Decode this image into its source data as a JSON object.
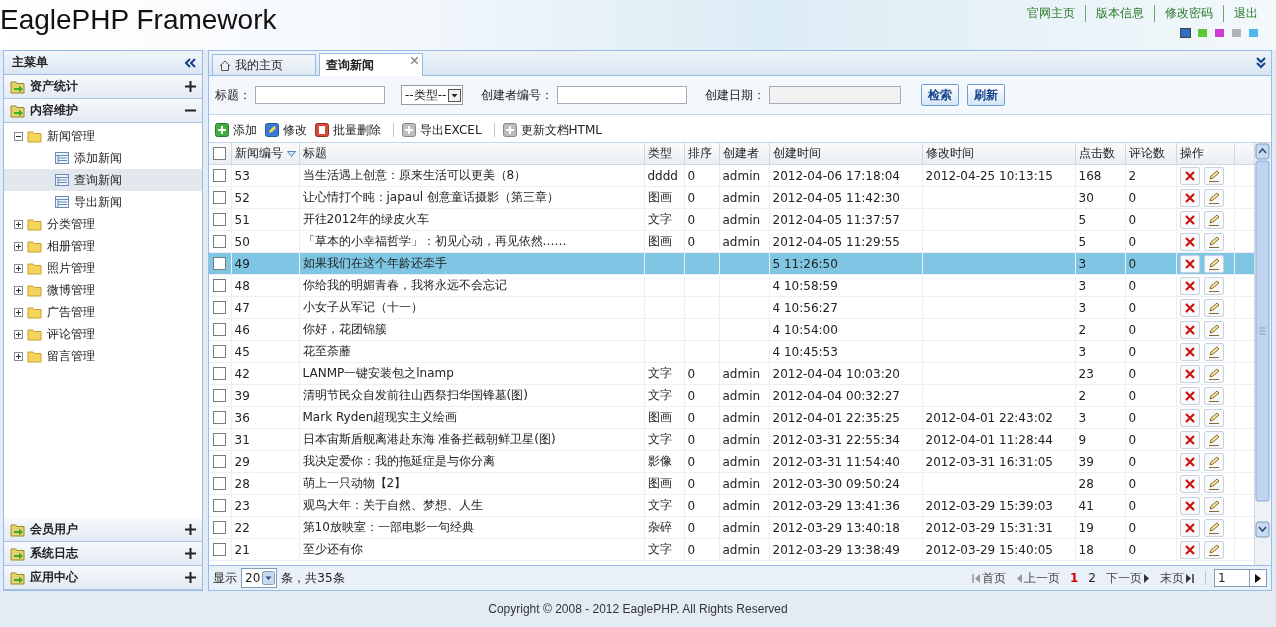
{
  "header": {
    "title": "EaglePHP Framework",
    "links": [
      "官网主页",
      "版本信息",
      "修改密码",
      "退出"
    ],
    "swatches": [
      {
        "color": "#2a6fc0",
        "selected": true
      },
      {
        "color": "#5cc92e",
        "selected": false
      },
      {
        "color": "#d23ad2",
        "selected": false
      },
      {
        "color": "#b4b4b4",
        "selected": false
      },
      {
        "color": "#4fb8ea",
        "selected": false
      }
    ]
  },
  "sidebar": {
    "title": "主菜单",
    "sections": [
      {
        "label": "资产统计",
        "expanded": false
      },
      {
        "label": "内容维护",
        "expanded": true,
        "tree": [
          {
            "label": "新闻管理",
            "expanded": true,
            "selected": false,
            "children": [
              {
                "label": "添加新闻",
                "selected": false
              },
              {
                "label": "查询新闻",
                "selected": true
              },
              {
                "label": "导出新闻",
                "selected": false
              }
            ]
          },
          {
            "label": "分类管理",
            "expanded": false,
            "selected": false
          },
          {
            "label": "相册管理",
            "expanded": false,
            "selected": false
          },
          {
            "label": "照片管理",
            "expanded": false,
            "selected": false
          },
          {
            "label": "微博管理",
            "expanded": false,
            "selected": false
          },
          {
            "label": "广告管理",
            "expanded": false,
            "selected": false
          },
          {
            "label": "评论管理",
            "expanded": false,
            "selected": false
          },
          {
            "label": "留言管理",
            "expanded": false,
            "selected": false
          }
        ]
      },
      {
        "label": "会员用户",
        "expanded": false
      },
      {
        "label": "系统日志",
        "expanded": false
      },
      {
        "label": "应用中心",
        "expanded": false
      }
    ]
  },
  "tabs": [
    {
      "label": "我的主页",
      "selected": false,
      "kind": "home"
    },
    {
      "label": "查询新闻",
      "selected": true,
      "kind": "closable"
    }
  ],
  "search": {
    "fields": [
      {
        "kind": "text",
        "label": "标题："
      },
      {
        "kind": "select",
        "value": "--类型--"
      },
      {
        "kind": "text",
        "label": "创建者编号："
      },
      {
        "kind": "date",
        "label": "创建日期："
      }
    ],
    "buttons": [
      "检索",
      "刷新"
    ]
  },
  "toolbar": [
    {
      "kind": "add",
      "label": "添加"
    },
    {
      "kind": "edit",
      "label": "修改"
    },
    {
      "kind": "delete",
      "label": "批量删除"
    },
    {
      "kind": "export",
      "label": "导出EXCEL"
    },
    {
      "kind": "export",
      "label": "更新文档HTML"
    }
  ],
  "table": {
    "all_checked": false,
    "columns": [
      {
        "label": "新闻编号",
        "sorted": true
      },
      {
        "label": "标题",
        "sorted": false
      },
      {
        "label": "类型",
        "sorted": false
      },
      {
        "label": "排序",
        "sorted": false
      },
      {
        "label": "创建者",
        "sorted": false
      },
      {
        "label": "创建时间",
        "sorted": false
      },
      {
        "label": "修改时间",
        "sorted": false
      },
      {
        "label": "点击数",
        "sorted": false
      },
      {
        "label": "评论数",
        "sorted": false
      },
      {
        "label": "操作",
        "sorted": false
      }
    ],
    "rows": [
      {
        "selected": false,
        "checked": false,
        "id": "53",
        "title": "当生活遇上创意：原来生活可以更美（8）",
        "type": "dddd",
        "order": "0",
        "creator": "admin",
        "created": "2012-04-06 17:18:04",
        "modified": "2012-04-25 10:13:15",
        "clicks": "168",
        "comments": "2"
      },
      {
        "selected": false,
        "checked": false,
        "id": "52",
        "title": "让心情打个盹：japaul 创意童话摄影（第三章）",
        "type": "图画",
        "order": "0",
        "creator": "admin",
        "created": "2012-04-05 11:42:30",
        "clicks": "30",
        "comments": "0"
      },
      {
        "selected": false,
        "checked": false,
        "id": "51",
        "title": "开往2012年的绿皮火车",
        "type": "文字",
        "order": "0",
        "creator": "admin",
        "created": "2012-04-05 11:37:57",
        "clicks": "5",
        "comments": "0"
      },
      {
        "selected": false,
        "checked": false,
        "id": "50",
        "title": "「草本的小幸福哲学」：初见心动，再见依然……",
        "type": "图画",
        "order": "0",
        "creator": "admin",
        "created": "2012-04-05 11:29:55",
        "clicks": "5",
        "comments": "0"
      },
      {
        "selected": true,
        "checked": false,
        "id": "49",
        "title": "如果我们在这个年龄还牵手",
        "created": "5 11:26:50",
        "clicks": "3",
        "comments": "0"
      },
      {
        "selected": false,
        "checked": false,
        "id": "48",
        "title": "你给我的明媚青春，我将永远不会忘记",
        "created": "4 10:58:59",
        "clicks": "3",
        "comments": "0"
      },
      {
        "selected": false,
        "checked": false,
        "id": "47",
        "title": "小女子从军记（十一）",
        "created": "4 10:56:27",
        "clicks": "3",
        "comments": "0"
      },
      {
        "selected": false,
        "checked": false,
        "id": "46",
        "title": "你好，花团锦簇",
        "created": "4 10:54:00",
        "clicks": "2",
        "comments": "0"
      },
      {
        "selected": false,
        "checked": false,
        "id": "45",
        "title": "花至荼蘼",
        "created": "4 10:45:53",
        "clicks": "3",
        "comments": "0"
      },
      {
        "selected": false,
        "checked": false,
        "id": "42",
        "title": "LANMP一键安装包之lnamp",
        "type": "文字",
        "order": "0",
        "creator": "admin",
        "created": "2012-04-04 10:03:20",
        "clicks": "23",
        "comments": "0"
      },
      {
        "selected": false,
        "checked": false,
        "id": "39",
        "title": "清明节民众自发前往山西祭扫华国锋墓(图)",
        "type": "文字",
        "order": "0",
        "creator": "admin",
        "created": "2012-04-04 00:32:27",
        "clicks": "2",
        "comments": "0"
      },
      {
        "selected": false,
        "checked": false,
        "id": "36",
        "title": "Mark Ryden超现实主义绘画",
        "type": "图画",
        "order": "0",
        "creator": "admin",
        "created": "2012-04-01 22:35:25",
        "modified": "2012-04-01 22:43:02",
        "clicks": "3",
        "comments": "0"
      },
      {
        "selected": false,
        "checked": false,
        "id": "31",
        "title": "日本宙斯盾舰离港赴东海 准备拦截朝鲜卫星(图)",
        "type": "文字",
        "order": "0",
        "creator": "admin",
        "created": "2012-03-31 22:55:34",
        "modified": "2012-04-01 11:28:44",
        "clicks": "9",
        "comments": "0"
      },
      {
        "selected": false,
        "checked": false,
        "id": "29",
        "title": "我决定爱你：我的拖延症是与你分离",
        "type": "影像",
        "order": "0",
        "creator": "admin",
        "created": "2012-03-31 11:54:40",
        "modified": "2012-03-31 16:31:05",
        "clicks": "39",
        "comments": "0"
      },
      {
        "selected": false,
        "checked": false,
        "id": "28",
        "title": "萌上一只动物【2】",
        "type": "图画",
        "order": "0",
        "creator": "admin",
        "created": "2012-03-30 09:50:24",
        "clicks": "28",
        "comments": "0"
      },
      {
        "selected": false,
        "checked": false,
        "id": "23",
        "title": "观鸟大年：关于自然、梦想、人生",
        "type": "文字",
        "order": "0",
        "creator": "admin",
        "created": "2012-03-29 13:41:36",
        "modified": "2012-03-29 15:39:03",
        "clicks": "41",
        "comments": "0"
      },
      {
        "selected": false,
        "checked": false,
        "id": "22",
        "title": "第10放映室：一部电影一句经典",
        "type": "杂碎",
        "order": "0",
        "creator": "admin",
        "created": "2012-03-29 13:40:18",
        "modified": "2012-03-29 15:31:31",
        "clicks": "19",
        "comments": "0"
      },
      {
        "selected": false,
        "checked": false,
        "id": "21",
        "title": "至少还有你",
        "type": "文字",
        "order": "0",
        "creator": "admin",
        "created": "2012-03-29 13:38:49",
        "modified": "2012-03-29 15:40:05",
        "clicks": "18",
        "comments": "0"
      }
    ]
  },
  "pager": {
    "show_label": "显示",
    "page_size": "20",
    "total": "条，共35条",
    "first": "首页",
    "prev": "上一页",
    "pages": [
      {
        "label": "1",
        "selected": true
      },
      {
        "label": "2",
        "selected": false
      }
    ],
    "next": "下一页",
    "last": "末页",
    "page_input": "1"
  },
  "footer": "Copyright © 2008 - 2012 EaglePHP. All Rights Reserved"
}
